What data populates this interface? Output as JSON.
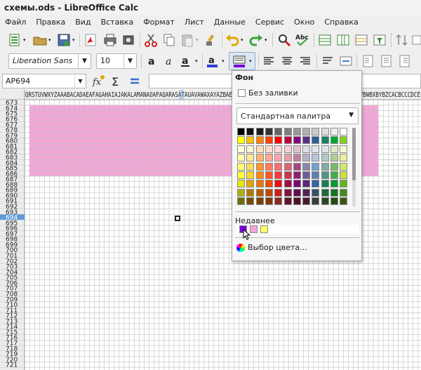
{
  "window": {
    "title": "схемы.ods - LibreOffice Calc"
  },
  "menu": [
    "Файл",
    "Правка",
    "Вид",
    "Вставка",
    "Формат",
    "Лист",
    "Данные",
    "Сервис",
    "Окно",
    "Справка"
  ],
  "toolbar": {
    "font_name": "Liberation Sans",
    "font_size": "10"
  },
  "formula_bar": {
    "name_box": "AP694",
    "formula": ""
  },
  "sheet": {
    "column_letters": "QRSTUVWXYZAAABACADAEAFAGAHAIAJAKALAMANAOAPAQARASATAUAVAWAXAYAZBABBBCBDBEBFBGBHBIBJBKBLBMBNBOBPBQBRBSBTBUBVBWBXBYBZCACBCCCDCE",
    "rows_start": 673,
    "rows_end": 721,
    "active_row": 694,
    "pink_fill_rows": [
      674,
      686
    ],
    "fill_color": "#f4a6d8",
    "header_active_color": "#5e9ad7"
  },
  "color_popup": {
    "header": "Фон",
    "no_fill": "Без заливки",
    "palette_name": "Стандартная палитра",
    "recent_label": "Недавнее",
    "recent_colors": [
      "#7b00e0",
      "#f4a6d8",
      "#ffff66"
    ],
    "custom_color": "Выбор цвета...",
    "palette": [
      [
        "#000000",
        "#111111",
        "#1c1c1c",
        "#333333",
        "#666666",
        "#808080",
        "#999999",
        "#b2b2b2",
        "#cccccc",
        "#dddddd",
        "#eeeeee",
        "#ffffff"
      ],
      [
        "#ffff00",
        "#ffbf00",
        "#ff8000",
        "#ff4000",
        "#ff0000",
        "#bf0041",
        "#800080",
        "#55308d",
        "#2a6099",
        "#158466",
        "#00a933",
        "#81d41a"
      ],
      [
        "#ffffd7",
        "#fff5ce",
        "#ffdbb6",
        "#ffd8ce",
        "#ffd7d7",
        "#f7d1d5",
        "#e0c2cd",
        "#dedce6",
        "#dee6ef",
        "#dee7e5",
        "#dde8cb",
        "#f6f9d4"
      ],
      [
        "#ffffa6",
        "#ffe994",
        "#ffb66c",
        "#ffaa95",
        "#ffa6a6",
        "#ec9ba4",
        "#bf819e",
        "#b7b3ca",
        "#b4c7dc",
        "#b3cac7",
        "#afd095",
        "#e8f2a1"
      ],
      [
        "#ffff6d",
        "#ffde59",
        "#ff972f",
        "#ff7b59",
        "#ff6d6d",
        "#e16173",
        "#a1467e",
        "#8e86ae",
        "#729fcf",
        "#81aca6",
        "#77bc65",
        "#d4ea6b"
      ],
      [
        "#ffff38",
        "#ffd428",
        "#ff860d",
        "#ff5429",
        "#ff3838",
        "#d62e4e",
        "#8d1d75",
        "#6b5e9b",
        "#5983b0",
        "#50938a",
        "#3faf46",
        "#c9e234"
      ],
      [
        "#e6e905",
        "#e8a202",
        "#ea7500",
        "#ed4c05",
        "#f10d0c",
        "#a7074b",
        "#780373",
        "#5b277d",
        "#3465a4",
        "#168253",
        "#069a2e",
        "#5eb91e"
      ],
      [
        "#acb20c",
        "#b47804",
        "#b85c00",
        "#be480a",
        "#c9211e",
        "#861141",
        "#650953",
        "#55215b",
        "#355269",
        "#1e6a39",
        "#127622",
        "#468a1a"
      ],
      [
        "#706e0c",
        "#784b04",
        "#7b3d00",
        "#813709",
        "#8d281e",
        "#611729",
        "#4e102d",
        "#481d32",
        "#383d3c",
        "#28471f",
        "#224b12",
        "#395511"
      ]
    ]
  }
}
